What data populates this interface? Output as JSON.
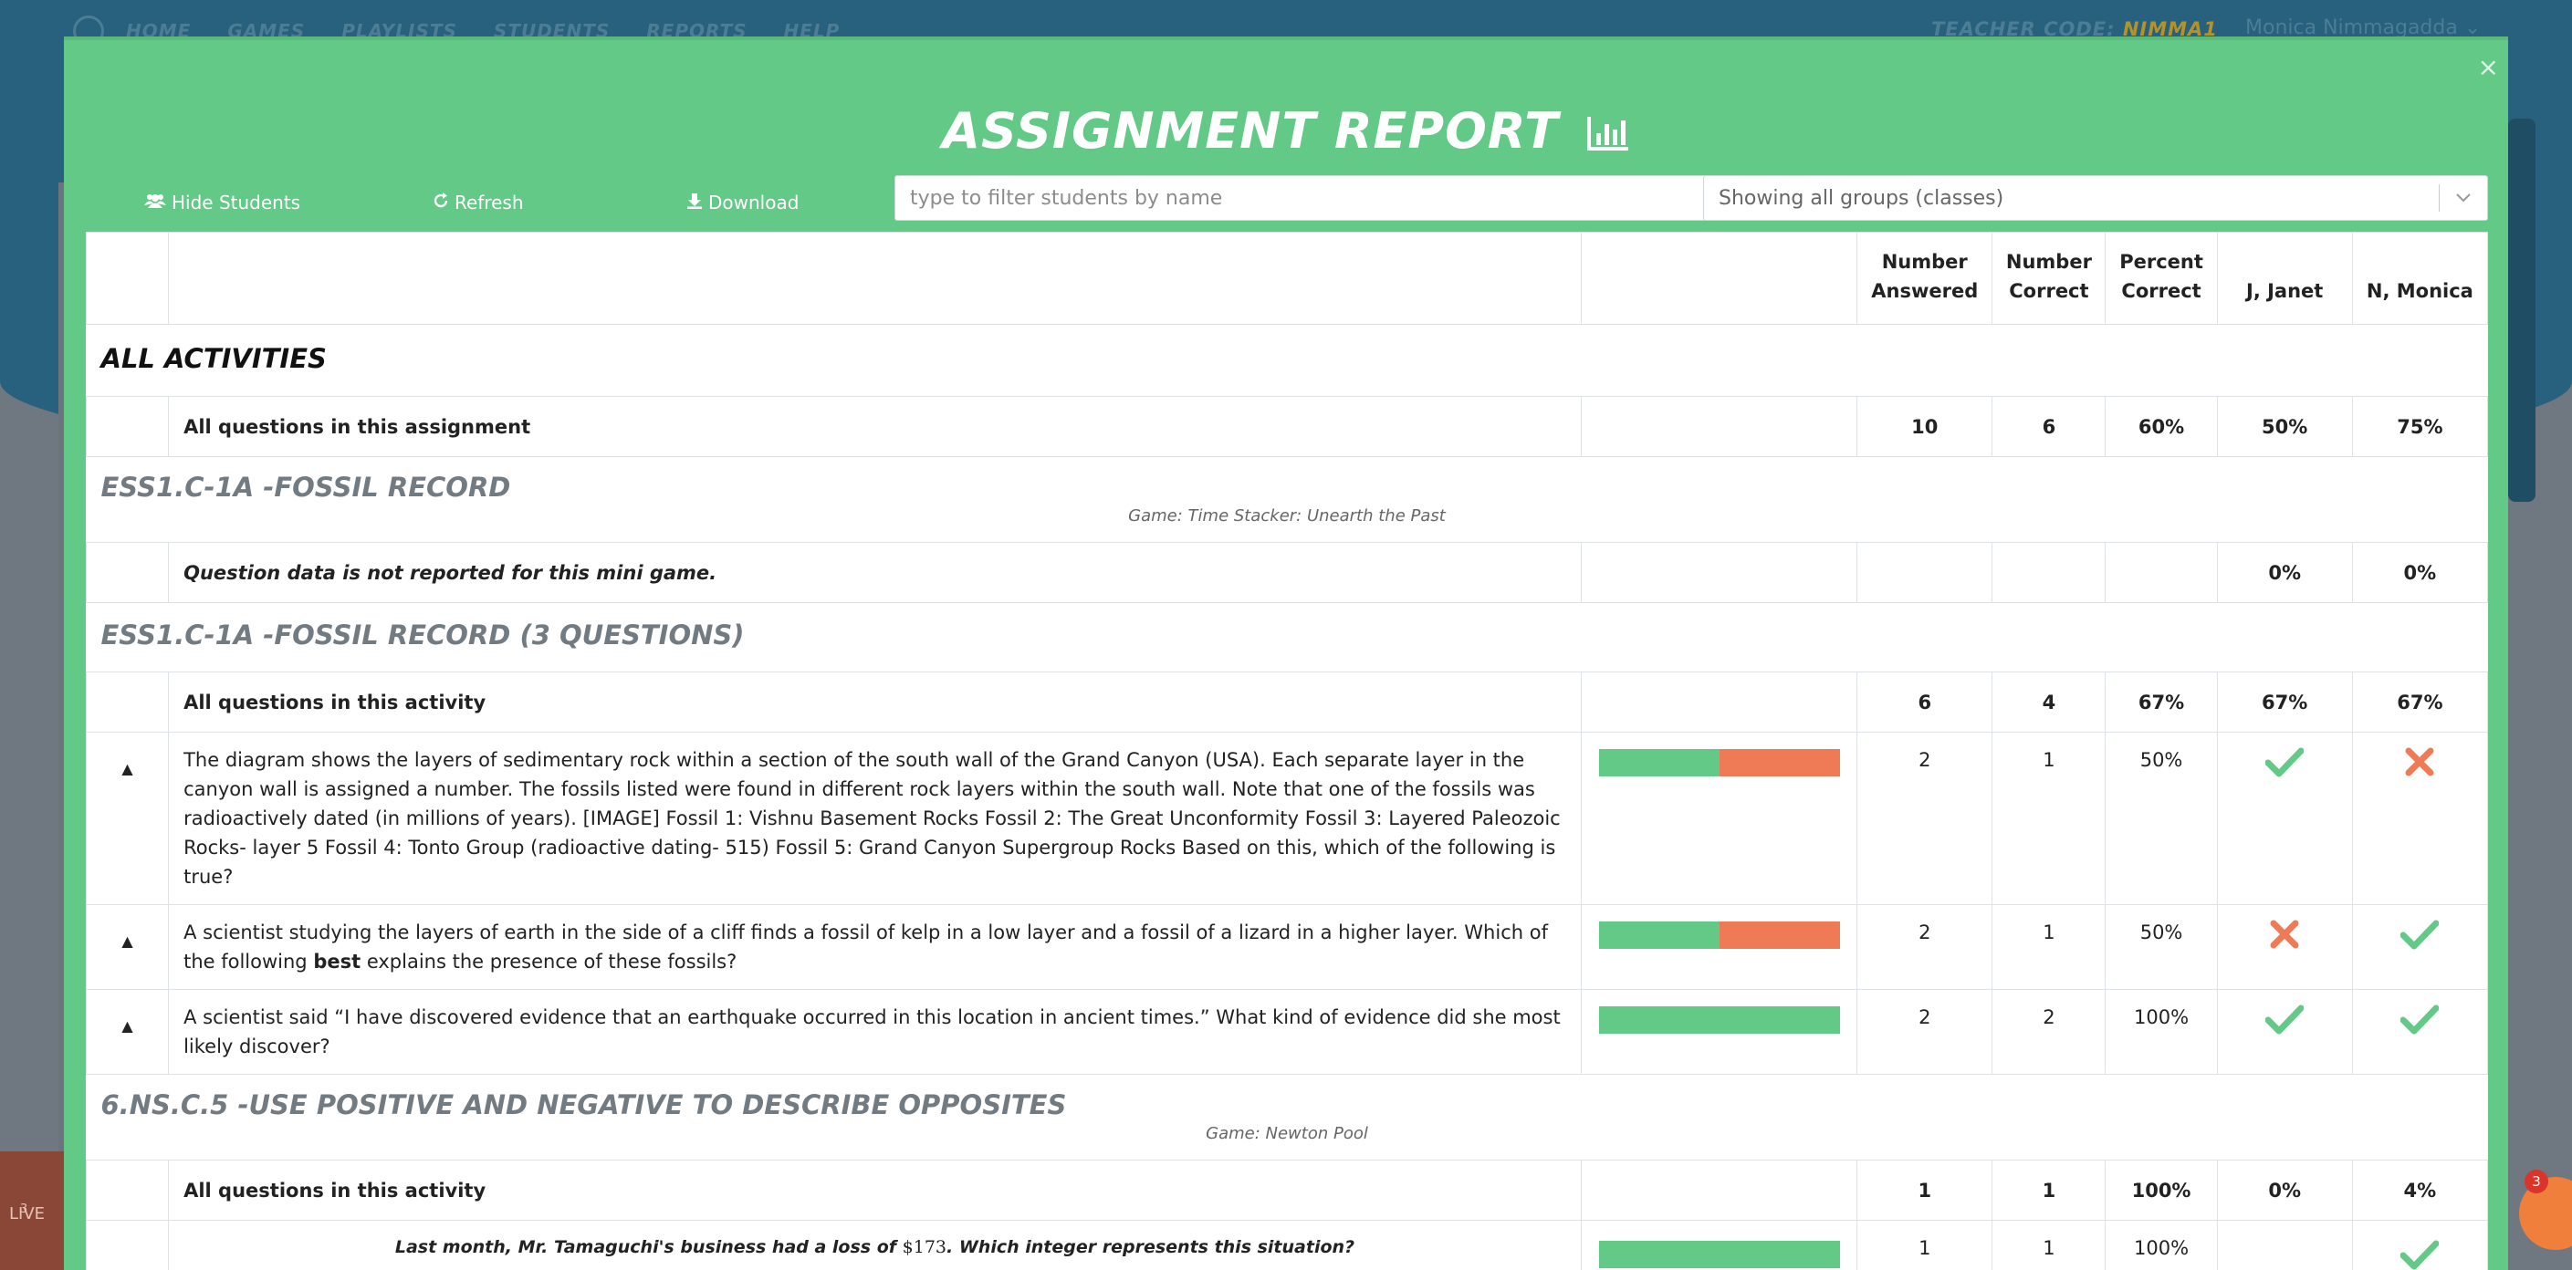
{
  "background": {
    "nav": [
      "HOME",
      "GAMES",
      "PLAYLISTS",
      "STUDENTS",
      "REPORTS",
      "HELP"
    ],
    "teacher_code_label": "TEACHER CODE:",
    "teacher_code": "NIMMA1",
    "user_name": "Monica Nimmagadda",
    "live_label": "LIVE",
    "live_count": "3"
  },
  "modal": {
    "title": "ASSIGNMENT REPORT",
    "close": "×",
    "toolbar": {
      "hide_students": "Hide Students",
      "refresh": "Refresh",
      "download": "Download"
    },
    "filter_placeholder": "type to filter students by name",
    "group_select": "Showing all groups (classes)"
  },
  "table": {
    "headers": {
      "number_answered": [
        "Number",
        "Answered"
      ],
      "number_correct": [
        "Number",
        "Correct"
      ],
      "percent_correct": [
        "Percent",
        "Correct"
      ],
      "students": [
        "J, Janet",
        "N, Monica"
      ]
    },
    "all_activities": "ALL ACTIVITIES",
    "all_row": {
      "label": "All questions in this assignment",
      "answered": "10",
      "correct": "6",
      "percent": "60%",
      "s1": "50%",
      "s2": "75%"
    },
    "sections": [
      {
        "title": "ESS1.C-1A -FOSSIL RECORD",
        "game": "Game: Time Stacker: Unearth the Past",
        "summary": {
          "label": "Question data is not reported for this mini game.",
          "s1": "0%",
          "s2": "0%"
        }
      },
      {
        "title": "ESS1.C-1A -FOSSIL RECORD (3 QUESTIONS)",
        "summary": {
          "label": "All questions in this activity",
          "answered": "6",
          "correct": "4",
          "percent": "67%",
          "s1": "67%",
          "s2": "67%"
        },
        "questions": [
          {
            "text": "The diagram shows the layers of sedimentary rock within a section of the south wall of the Grand Canyon (USA). Each separate layer in the canyon wall is assigned a number. The fossils listed were found in different rock layers within the south wall. Note that one of the fossils was radioactively dated (in millions of years). [IMAGE] Fossil 1: Vishnu Basement Rocks Fossil 2: The Great Unconformity Fossil 3: Layered Paleozoic Rocks- layer 5 Fossil 4: Tonto Group (radioactive dating- 515) Fossil 5: Grand Canyon Supergroup Rocks Based on this, which of the following is true?",
            "correct_fraction": 0.5,
            "answered": "2",
            "correct": "1",
            "percent": "50%",
            "s1": "check",
            "s2": "cross"
          },
          {
            "text_before": "A scientist studying the layers of earth in the side of a cliff finds a fossil of kelp in a low layer and a fossil of a lizard in a higher layer. Which of the following ",
            "text_bold": "best",
            "text_after": " explains the presence of these fossils?",
            "correct_fraction": 0.5,
            "answered": "2",
            "correct": "1",
            "percent": "50%",
            "s1": "cross",
            "s2": "check"
          },
          {
            "text": "A scientist said “I have discovered evidence that an earthquake occurred in this location in ancient times.” What kind of evidence did she most likely discover?",
            "correct_fraction": 1.0,
            "answered": "2",
            "correct": "2",
            "percent": "100%",
            "s1": "check",
            "s2": "check"
          }
        ]
      },
      {
        "title": "6.NS.C.5 -USE POSITIVE AND NEGATIVE TO DESCRIBE OPPOSITES",
        "game": "Game: Newton Pool",
        "summary": {
          "label": "All questions in this activity",
          "answered": "1",
          "correct": "1",
          "percent": "100%",
          "s1": "0%",
          "s2": "4%"
        },
        "partial_question": {
          "text_before": "Last month, Mr. Tamaguchi's business had a loss of ",
          "amount": "$173",
          "text_after": ". Which integer represents this situation?",
          "answered": "1",
          "correct": "1",
          "percent": "100%"
        }
      }
    ]
  },
  "chat_badge": "3",
  "colors": {
    "green": "#63c987",
    "red": "#ee7a56",
    "teal": "#27617d",
    "section_gray": "#737b82"
  }
}
